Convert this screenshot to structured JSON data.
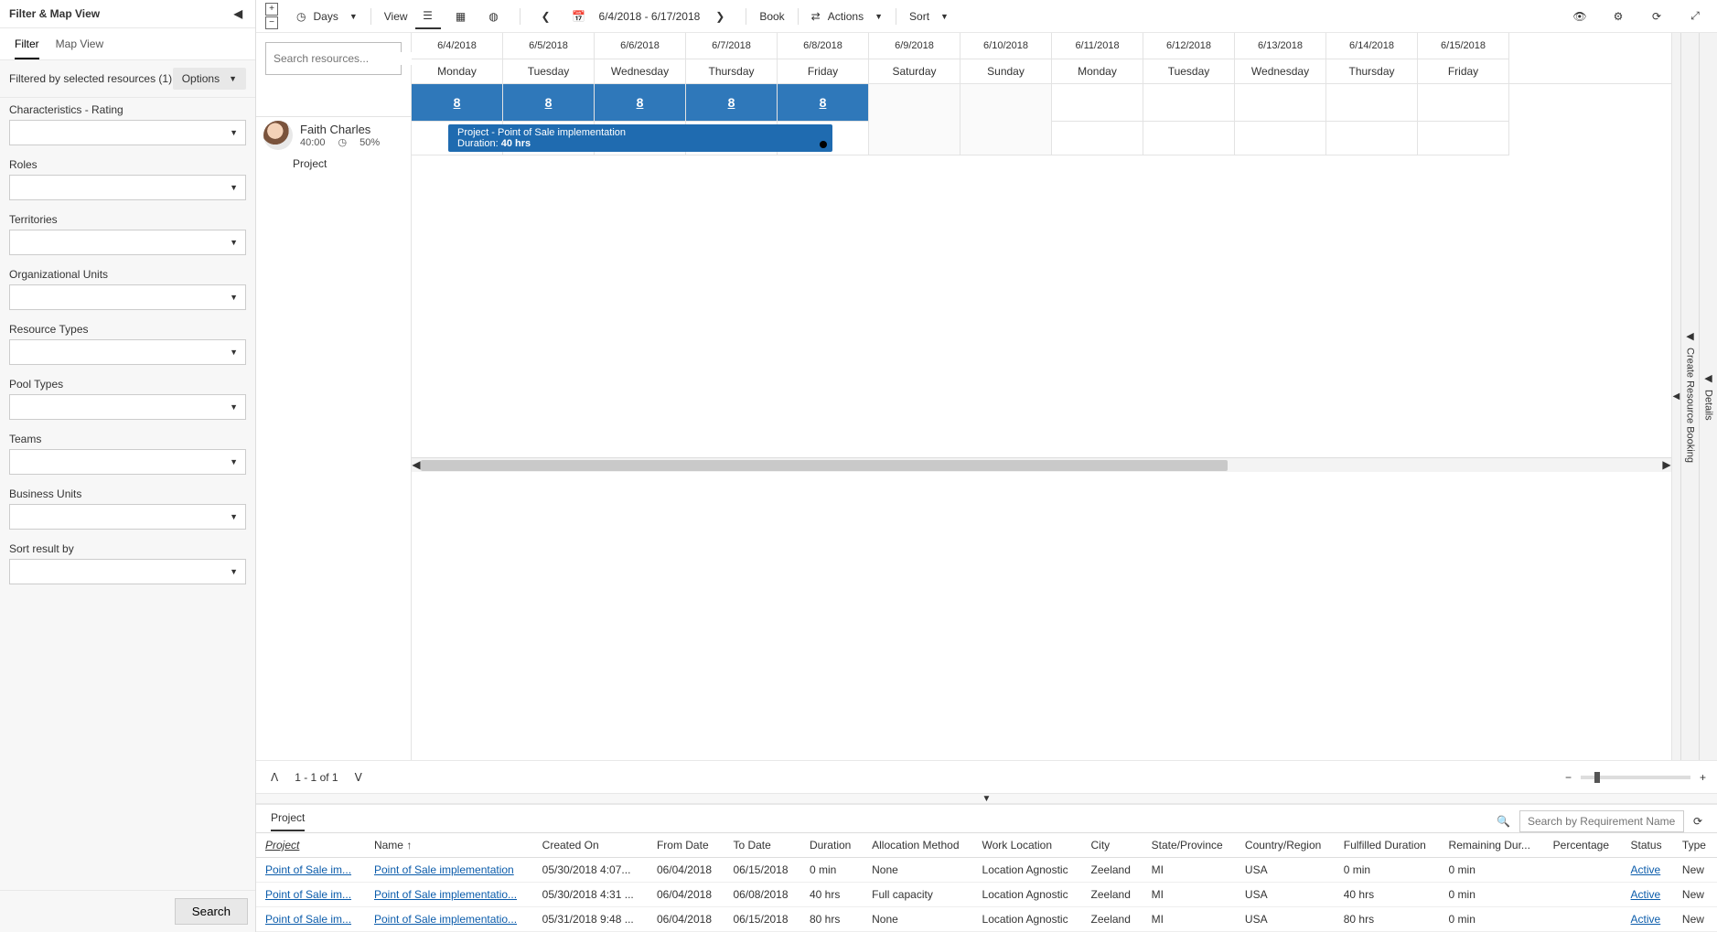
{
  "filter_panel": {
    "title": "Filter & Map View",
    "tabs": [
      "Filter",
      "Map View"
    ],
    "active_tab": 0,
    "status": "Filtered by selected resources (1)",
    "options_label": "Options",
    "groups": [
      "Characteristics - Rating",
      "Roles",
      "Territories",
      "Organizational Units",
      "Resource Types",
      "Pool Types",
      "Teams",
      "Business Units",
      "Sort result by"
    ],
    "search_button": "Search"
  },
  "toolbar": {
    "days_label": "Days",
    "view_label": "View",
    "date_range": "6/4/2018 - 6/17/2018",
    "book_label": "Book",
    "actions_label": "Actions",
    "sort_label": "Sort"
  },
  "schedule": {
    "search_placeholder": "Search resources...",
    "days": [
      {
        "date": "6/4/2018",
        "dow": "Monday"
      },
      {
        "date": "6/5/2018",
        "dow": "Tuesday"
      },
      {
        "date": "6/6/2018",
        "dow": "Wednesday"
      },
      {
        "date": "6/7/2018",
        "dow": "Thursday"
      },
      {
        "date": "6/8/2018",
        "dow": "Friday"
      },
      {
        "date": "6/9/2018",
        "dow": "Saturday"
      },
      {
        "date": "6/10/2018",
        "dow": "Sunday"
      },
      {
        "date": "6/11/2018",
        "dow": "Monday"
      },
      {
        "date": "6/12/2018",
        "dow": "Tuesday"
      },
      {
        "date": "6/13/2018",
        "dow": "Wednesday"
      },
      {
        "date": "6/14/2018",
        "dow": "Thursday"
      },
      {
        "date": "6/15/2018",
        "dow": "Friday"
      }
    ],
    "resource": {
      "name": "Faith Charles",
      "hours": "40:00",
      "util": "50%",
      "child_label": "Project"
    },
    "hours_cells": [
      "8",
      "8",
      "8",
      "8",
      "8"
    ],
    "block": {
      "title": "Project - Point of Sale implementation",
      "duration_label": "Duration:",
      "duration_value": "40 hrs"
    },
    "pager": "1 - 1 of 1"
  },
  "right_rails": {
    "create_booking": "Create Resource Booking",
    "details": "Details"
  },
  "bottom": {
    "tab": "Project",
    "search_placeholder": "Search by Requirement Name",
    "columns": [
      "Project",
      "Name",
      "Created On",
      "From Date",
      "To Date",
      "Duration",
      "Allocation Method",
      "Work Location",
      "City",
      "State/Province",
      "Country/Region",
      "Fulfilled Duration",
      "Remaining Dur...",
      "Percentage",
      "Status",
      "Type"
    ],
    "rows": [
      {
        "project": "Point of Sale im...",
        "name": "Point of Sale implementation",
        "created": "05/30/2018 4:07...",
        "from": "06/04/2018",
        "to": "06/15/2018",
        "duration": "0 min",
        "alloc": "None",
        "work": "Location Agnostic",
        "city": "Zeeland",
        "state": "MI",
        "country": "USA",
        "fulfilled": "0 min",
        "remaining": "0 min",
        "pct": "",
        "status": "Active",
        "type": "New"
      },
      {
        "project": "Point of Sale im...",
        "name": "Point of Sale implementatio...",
        "created": "05/30/2018 4:31 ...",
        "from": "06/04/2018",
        "to": "06/08/2018",
        "duration": "40 hrs",
        "alloc": "Full capacity",
        "work": "Location Agnostic",
        "city": "Zeeland",
        "state": "MI",
        "country": "USA",
        "fulfilled": "40 hrs",
        "remaining": "0 min",
        "pct": "",
        "status": "Active",
        "type": "New"
      },
      {
        "project": "Point of Sale im...",
        "name": "Point of Sale implementatio...",
        "created": "05/31/2018 9:48 ...",
        "from": "06/04/2018",
        "to": "06/15/2018",
        "duration": "80 hrs",
        "alloc": "None",
        "work": "Location Agnostic",
        "city": "Zeeland",
        "state": "MI",
        "country": "USA",
        "fulfilled": "80 hrs",
        "remaining": "0 min",
        "pct": "",
        "status": "Active",
        "type": "New"
      }
    ]
  }
}
